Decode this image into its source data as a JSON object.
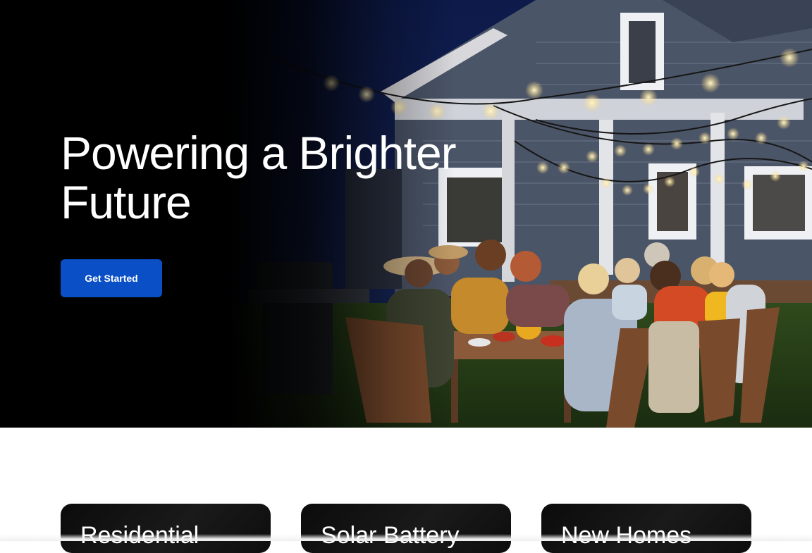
{
  "hero": {
    "title_line1": "Powering a Brighter",
    "title_line2": "Future",
    "cta_label": "Get Started",
    "image_subject": "family-dinner-outdoors-string-lights"
  },
  "cards": [
    {
      "title": "Residential"
    },
    {
      "title": "Solar Battery"
    },
    {
      "title": "New Homes"
    }
  ],
  "colors": {
    "hero_background": "#000000",
    "cta_background": "#0a4fc6",
    "card_background": "#111111",
    "page_background": "#ffffff"
  }
}
